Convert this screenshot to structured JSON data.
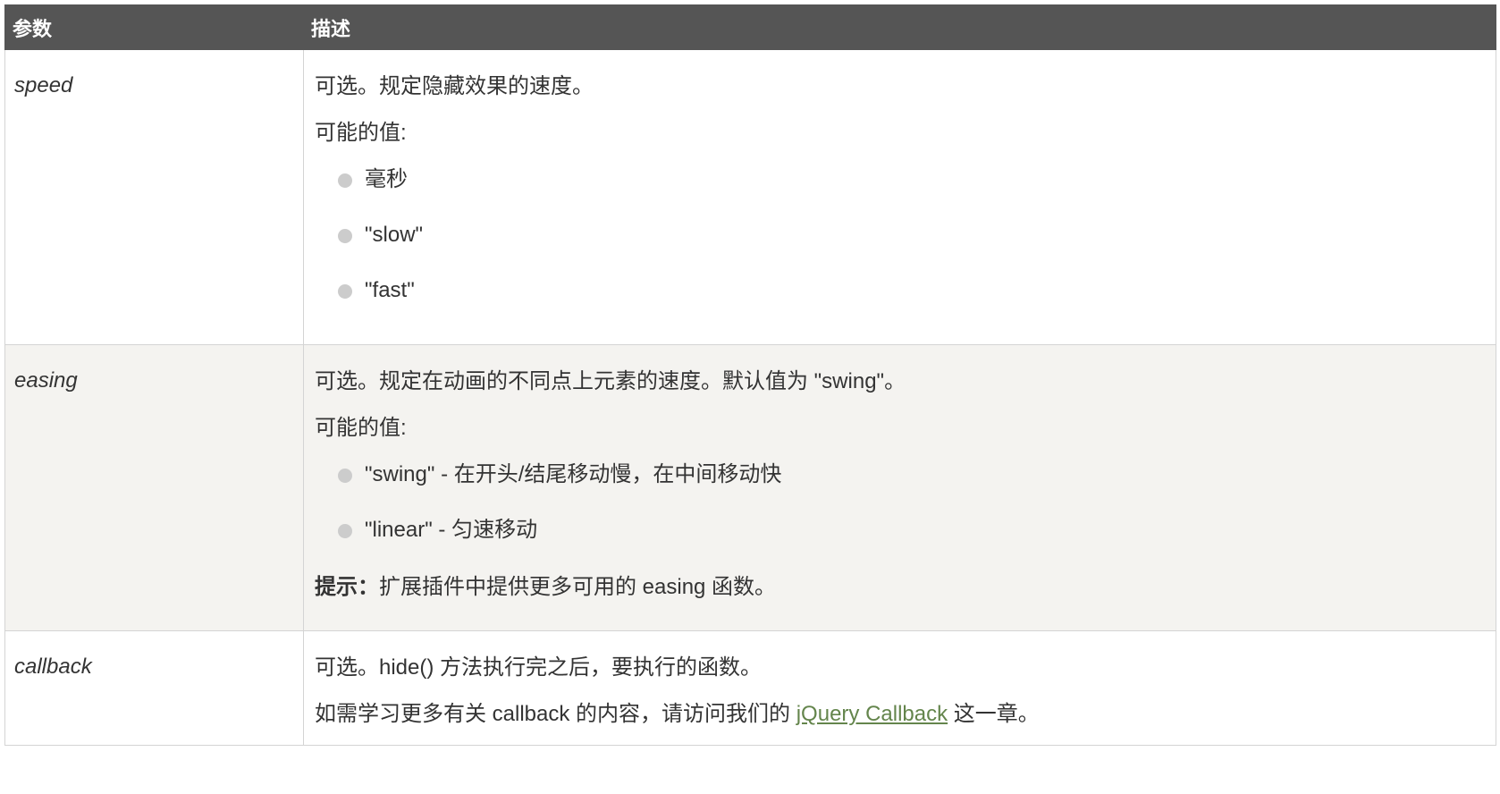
{
  "table": {
    "headers": [
      "参数",
      "描述"
    ],
    "rows": [
      {
        "param": "speed",
        "desc_line1": "可选。规定隐藏效果的速度。",
        "desc_line2": "可能的值:",
        "values": [
          "毫秒",
          "\"slow\"",
          "\"fast\""
        ]
      },
      {
        "param": "easing",
        "desc_line1": "可选。规定在动画的不同点上元素的速度。默认值为 \"swing\"。",
        "desc_line2": "可能的值:",
        "values": [
          "\"swing\" - 在开头/结尾移动慢，在中间移动快",
          "\"linear\" - 匀速移动"
        ],
        "tip_label": "提示：",
        "tip_text": "扩展插件中提供更多可用的 easing 函数。"
      },
      {
        "param": "callback",
        "desc_line1": "可选。hide() 方法执行完之后，要执行的函数。",
        "desc_line2_prefix": "如需学习更多有关 callback 的内容，请访问我们的 ",
        "link_text": "jQuery Callback",
        "desc_line2_suffix": " 这一章。"
      }
    ]
  },
  "colors": {
    "header_bg": "#555555",
    "alt_row_bg": "#f4f3f0",
    "link": "#64854c",
    "bullet": "#cccccc"
  }
}
